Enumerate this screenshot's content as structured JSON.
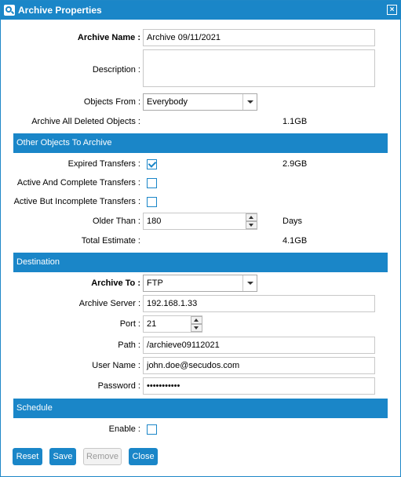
{
  "window": {
    "title": "Archive Properties",
    "close": "×"
  },
  "form": {
    "archive_name": {
      "label": "Archive Name :",
      "value": "Archive 09/11/2021"
    },
    "description": {
      "label": "Description :",
      "value": ""
    },
    "objects_from": {
      "label": "Objects From :",
      "value": "Everybody"
    },
    "archive_deleted": {
      "label": "Archive All Deleted Objects :",
      "value": "1.1GB"
    }
  },
  "other_objects": {
    "header": "Other Objects To Archive",
    "expired": {
      "label": "Expired Transfers :",
      "checked": true,
      "size": "2.9GB"
    },
    "active_complete": {
      "label": "Active And Complete Transfers :",
      "checked": false
    },
    "active_incomplete": {
      "label": "Active But Incomplete Transfers :",
      "checked": false
    },
    "older_than": {
      "label": "Older Than :",
      "value": "180",
      "unit": "Days"
    },
    "total_estimate": {
      "label": "Total Estimate :",
      "value": "4.1GB"
    }
  },
  "destination": {
    "header": "Destination",
    "archive_to": {
      "label": "Archive To :",
      "value": "FTP"
    },
    "server": {
      "label": "Archive Server :",
      "value": "192.168.1.33"
    },
    "port": {
      "label": "Port :",
      "value": "21"
    },
    "path": {
      "label": "Path :",
      "value": "/archieve09112021"
    },
    "user": {
      "label": "User Name :",
      "value": "john.doe@secudos.com"
    },
    "password": {
      "label": "Password :",
      "value": "•••••••••••"
    }
  },
  "schedule": {
    "header": "Schedule",
    "enable": {
      "label": "Enable :",
      "checked": false
    }
  },
  "buttons": {
    "reset": "Reset",
    "save": "Save",
    "remove": "Remove",
    "close": "Close"
  }
}
